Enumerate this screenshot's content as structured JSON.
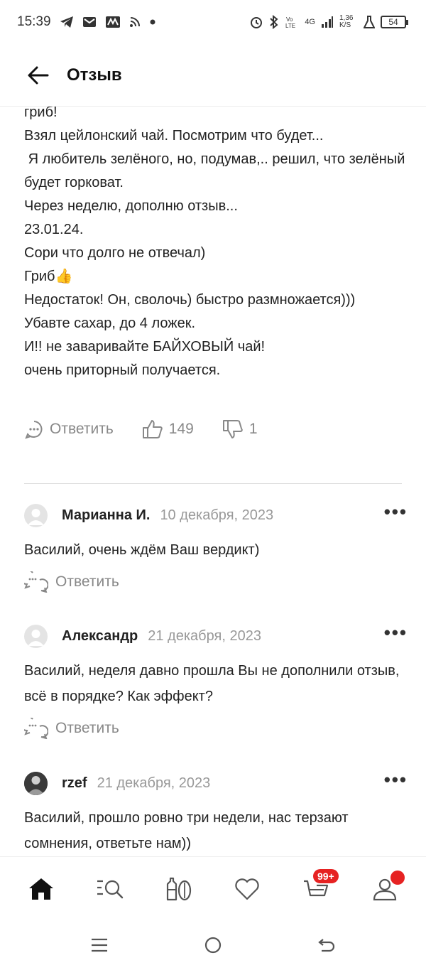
{
  "status_bar": {
    "time": "15:39",
    "network": "4G",
    "speed": "1,36 K/S",
    "battery": "54"
  },
  "header": {
    "title": "Отзыв"
  },
  "review": {
    "lines": [
      "гриб!",
      "Взял цейлонский чай. Посмотрим что будет...",
      " Я любитель зелёного, но, подумав,.. решил, что зелёный будет горковат.",
      "Через неделю, дополню отзыв...",
      "23.01.24.",
      "Сори что долго не отвечал)",
      "Гриб👍",
      "Недостаток! Он, сволочь) быстро размножается)))",
      "Убавте сахар, до 4 ложек.",
      "И!! не заваривайте БАЙХОВЫЙ чай!",
      "очень приторный получается."
    ],
    "reply_label": "Ответить",
    "likes": "149",
    "dislikes": "1"
  },
  "comments": [
    {
      "author": "Марианна И.",
      "date": "10 декабря, 2023",
      "text": "Василий, очень ждём Ваш вердикт)",
      "reply_label": "Ответить"
    },
    {
      "author": "Александр",
      "date": "21 декабря, 2023",
      "text": "Василий, неделя давно прошла Вы не дополнили отзыв, всё в порядке? Как эффект?",
      "reply_label": "Ответить"
    },
    {
      "author": "rzef",
      "date": "21 декабря, 2023",
      "text": "Василий, прошло ровно три недели, нас терзают сомнения, ответьте нам))",
      "reply_label": ""
    }
  ],
  "bottom_nav": {
    "cart_badge": "99+"
  },
  "colors": {
    "accent_red": "#e62222",
    "muted_text": "#888888"
  }
}
